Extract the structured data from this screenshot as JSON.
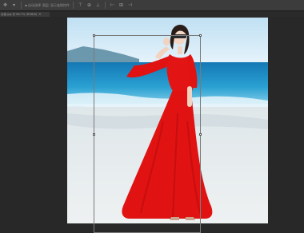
{
  "options_bar": {
    "items": [
      {
        "icon": "move-tool-icon",
        "glyph": "✥",
        "text": ""
      },
      {
        "icon": "dropdown-arrow-icon",
        "glyph": "▾",
        "text": ""
      },
      {
        "icon": "",
        "glyph": "",
        "text": "▪ 自动选择"
      },
      {
        "icon": "",
        "glyph": "",
        "text": "图层"
      },
      {
        "icon": "",
        "glyph": "",
        "text": "显示变换控件"
      },
      {
        "icon": "align-top-icon",
        "glyph": "⊤",
        "text": ""
      },
      {
        "icon": "align-vcenter-icon",
        "glyph": "⊕",
        "text": ""
      },
      {
        "icon": "align-bottom-icon",
        "glyph": "⊥",
        "text": ""
      },
      {
        "icon": "align-left-icon",
        "glyph": "⊢",
        "text": ""
      },
      {
        "icon": "align-hcenter-icon",
        "glyph": "⊞",
        "text": ""
      },
      {
        "icon": "align-right-icon",
        "glyph": "⊣",
        "text": ""
      }
    ]
  },
  "document_tab": {
    "label": "女装.jpg @ 66.7% (RGB/8)",
    "close_glyph": "×"
  },
  "canvas": {
    "background": "#282828",
    "dress_color": "#e01212",
    "sea_color": "#1f8fc4",
    "sky_color": "#d9eef9",
    "sand_color": "#e6ecef"
  }
}
